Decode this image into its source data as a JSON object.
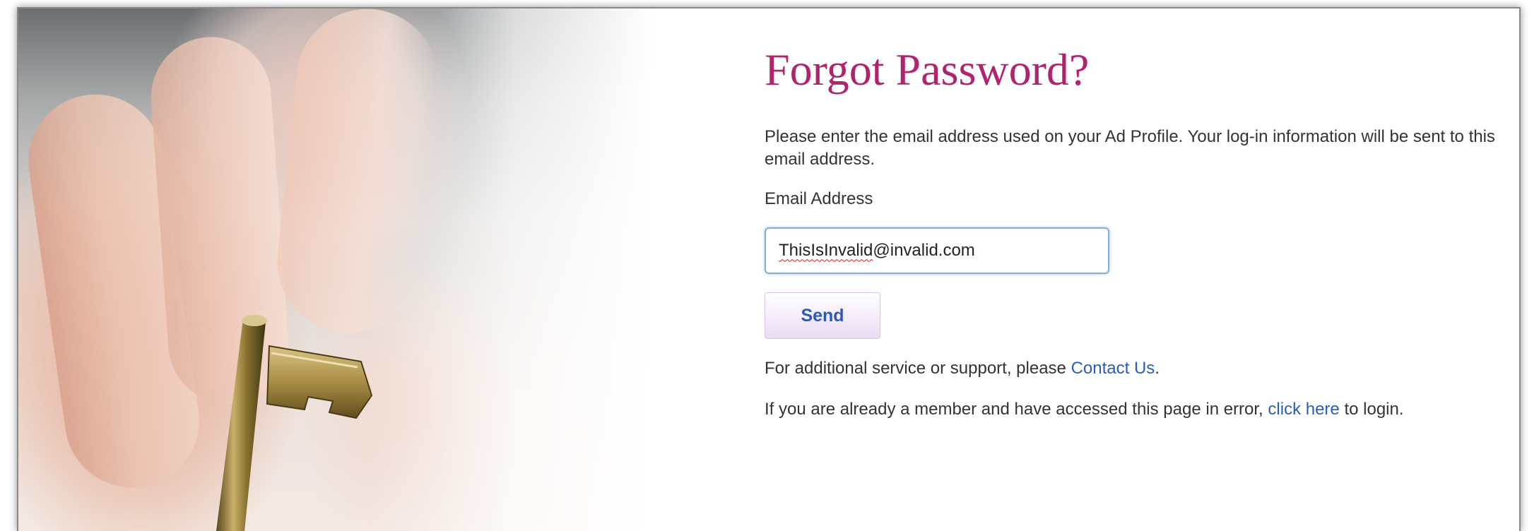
{
  "page": {
    "title": "Forgot Password?",
    "intro": "Please enter the email address used on your Ad Profile. Your log-in information will be sent to this email address."
  },
  "form": {
    "email_label": "Email Address",
    "email_value_misspelled": "ThisIsInvalid",
    "email_value_rest": "@invalid.com",
    "send_label": "Send"
  },
  "support": {
    "prefix": "For additional service or support, please ",
    "contact_link": "Contact Us",
    "suffix": "."
  },
  "login_note": {
    "prefix": "If you are already a member and have accessed this page in error, ",
    "link": "click here",
    "suffix": " to login."
  },
  "colors": {
    "title": "#b0246e",
    "link": "#2a5db5",
    "button_text": "#2b59b5",
    "input_border": "#7fb2d9"
  },
  "icons": {
    "hero_image": "hand-with-key-image"
  }
}
